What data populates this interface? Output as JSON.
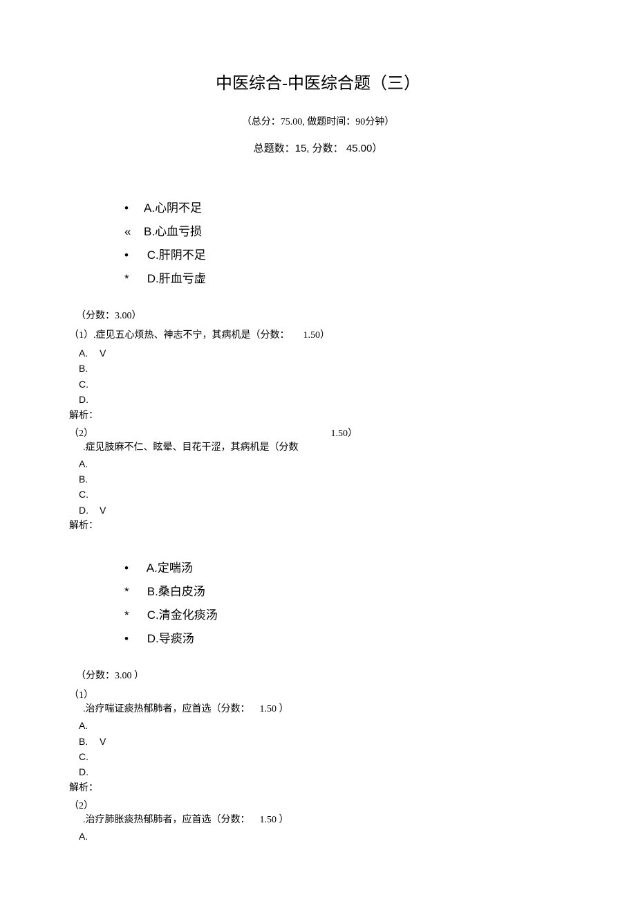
{
  "title": "中医综合-中医综合题（三）",
  "meta": {
    "line1": "（总分：75.00, 做题时间：90分钟）",
    "line2": "总题数：15, 分数：     45.00）"
  },
  "group1": {
    "options": [
      {
        "bullet": "•",
        "code": "A.",
        "text": "心阴不足"
      },
      {
        "bullet": "«",
        "code": "B.",
        "text": "心血亏损"
      },
      {
        "bullet": "•",
        "code": "C.",
        "text": "肝阴不足"
      },
      {
        "bullet": "*",
        "code": "D.",
        "text": "肝血亏虚"
      }
    ],
    "score_line": "（分数：3.00）",
    "q1": {
      "num": "（1）",
      "text": ".症见五心烦热、神志不宁，其病机是（分数：",
      "score": "1.50）",
      "answers": [
        "A.",
        "B.",
        "C.",
        "D."
      ],
      "correct": 0,
      "analysis": "解析："
    },
    "q2": {
      "num": "（2）",
      "score": "1.50）",
      "text": ".症见肢麻不仁、眩晕、目花干涩，其病机是（分数",
      "answers": [
        "A.",
        "B.",
        "C.",
        "D."
      ],
      "correct": 3,
      "analysis": "解析："
    }
  },
  "group2": {
    "options": [
      {
        "bullet": "•",
        "code": "A.",
        "text": "定喘汤"
      },
      {
        "bullet": "*",
        "code": "B.",
        "text": "桑白皮汤"
      },
      {
        "bullet": "*",
        "code": "C.",
        "text": "清金化痰汤"
      },
      {
        "bullet": "•",
        "code": "D.",
        "text": "导痰汤"
      }
    ],
    "score_line": "（分数：3.00 ）",
    "q1": {
      "num": "（1）",
      "text": ".治疗喘证痰热郁肺者，应首选（分数：",
      "score": "1.50 ）",
      "answers": [
        "A.",
        "B.",
        "C.",
        "D."
      ],
      "correct": 1,
      "analysis": "解析："
    },
    "q2": {
      "num": "（2）",
      "text": ".治疗肺胀痰热郁肺者，应首选（分数：",
      "score": "1.50 ）",
      "answers": [
        "A."
      ]
    }
  },
  "check_mark": "V"
}
